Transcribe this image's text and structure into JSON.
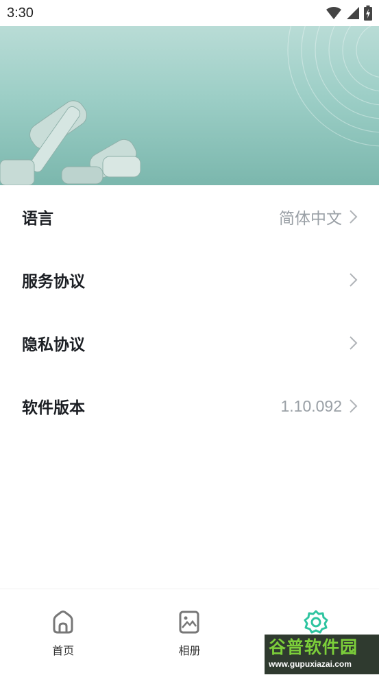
{
  "status_bar": {
    "time": "3:30",
    "icons": [
      "wifi-icon",
      "signal-icon",
      "battery-charging-icon"
    ]
  },
  "hero": {
    "image": "product-banner",
    "colors": {
      "top": "#b9dcd6",
      "bottom": "#7bb7ad"
    }
  },
  "settings": [
    {
      "label": "语言",
      "value": "简体中文"
    },
    {
      "label": "服务协议",
      "value": ""
    },
    {
      "label": "隐私协议",
      "value": ""
    },
    {
      "label": "软件版本",
      "value": "1.10.092"
    }
  ],
  "tabbar": {
    "tabs": [
      {
        "label": "首页",
        "icon": "home-icon"
      },
      {
        "label": "相册",
        "icon": "gallery-icon"
      },
      {
        "label": "设置",
        "icon": "settings-icon",
        "active": true
      }
    ],
    "active_color": "#2ec4a0"
  },
  "watermark": {
    "title": "谷普软件园",
    "url": "www.gupuxiazai.com"
  }
}
